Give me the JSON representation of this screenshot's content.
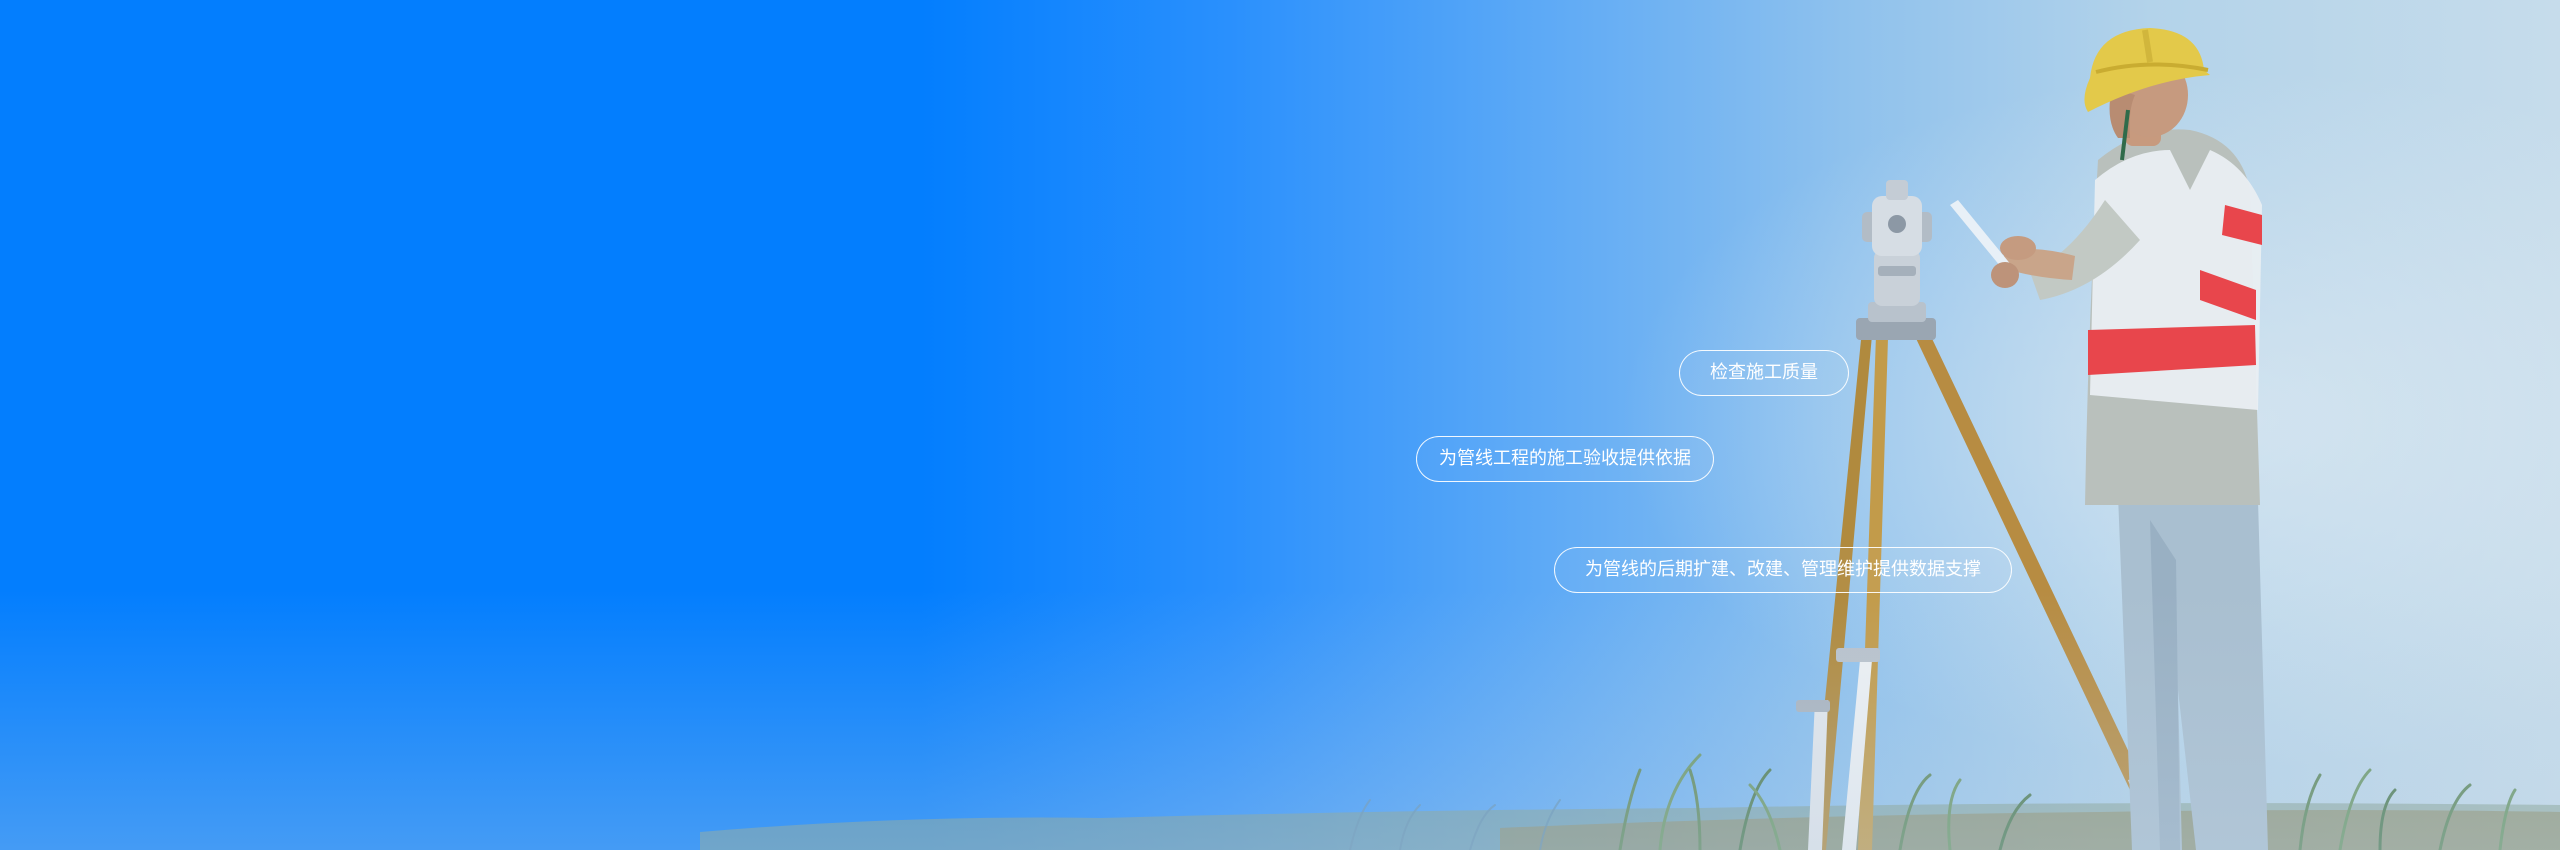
{
  "banner": {
    "tags": [
      {
        "label": "检查施工质量"
      },
      {
        "label": "为管线工程的施工验收提供依据"
      },
      {
        "label": "为管线的后期扩建、改建、管理维护提供数据支撑"
      }
    ],
    "illustration": {
      "subject": "surveyor-with-theodolite",
      "colors": {
        "background_left": "#037efe",
        "background_right": "#c6dceb",
        "helmet": "#e3c94a",
        "vest_stripe": "#e8464c",
        "grass": "#5f8a5e"
      }
    }
  }
}
